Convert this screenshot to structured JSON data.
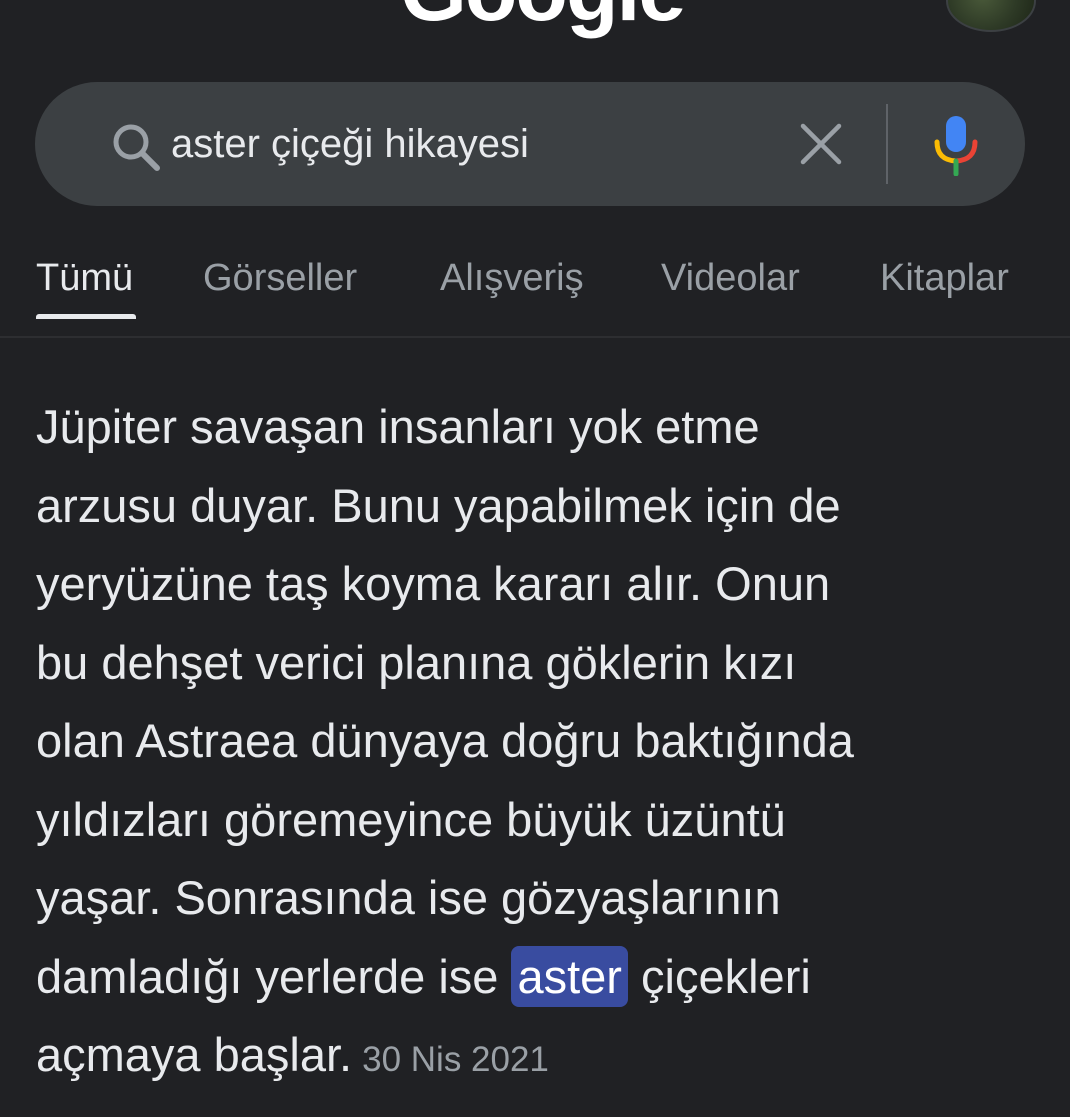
{
  "header": {
    "logo_text": "Google"
  },
  "search": {
    "query": "aster çiçeği hikayesi",
    "clear_icon": "close-icon",
    "search_icon": "search-icon",
    "mic_icon": "microphone-icon"
  },
  "tabs": [
    {
      "label": "Tümü",
      "active": true
    },
    {
      "label": "Görseller",
      "active": false
    },
    {
      "label": "Alışveriş",
      "active": false
    },
    {
      "label": "Videolar",
      "active": false
    },
    {
      "label": "Kitaplar",
      "active": false
    }
  ],
  "snippet": {
    "lines": [
      "Jüpiter savaşan insanları yok etme",
      "arzusu duyar. Bunu yapabilmek için de",
      "yeryüzüne taş koyma kararı alır. Onun",
      "bu dehşet verici planına göklerin kızı",
      "olan Astraea dünyaya doğru baktığında",
      "yıldızları göremeyince büyük üzüntü",
      "yaşar. Sonrasında ise gözyaşlarının"
    ],
    "line8_before": "damladığı yerlerde ise ",
    "line8_highlight": "aster",
    "line8_after": " çiçekleri",
    "last_line": "açmaya başlar.",
    "date": "30 Nis 2021"
  },
  "colors": {
    "background": "#202124",
    "search_bg": "#3c4043",
    "text": "#e8eaed",
    "muted": "#9aa0a6",
    "highlight": "#394ca0"
  }
}
